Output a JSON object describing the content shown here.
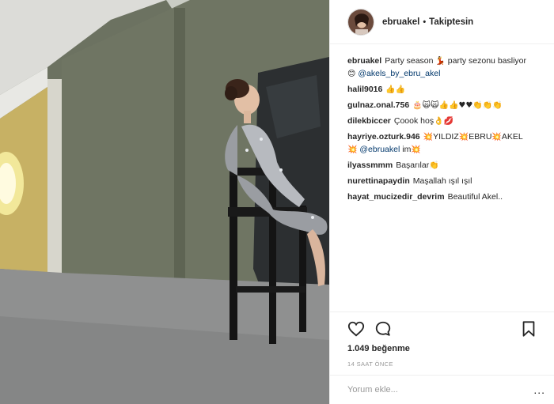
{
  "header": {
    "username": "ebruakel",
    "separator": "•",
    "follow_status": "Takiptesin"
  },
  "comments": [
    {
      "user": "ebruakel",
      "text_a": "Party season ",
      "emoji_a": "💃",
      "text_b": " party sezonu basliyor ",
      "emoji_b": "😊",
      "mention": " @akels_by_ebru_akel"
    },
    {
      "user": "halil9016",
      "emoji": "👍👍"
    },
    {
      "user": "gulnaz.onal.756",
      "emoji": "🎂🙀🙀👍👍♥♥👏👏👏"
    },
    {
      "user": "dilekbiccer",
      "text": "Çoook hoş",
      "emoji": "👌💋"
    },
    {
      "user": "hayriye.ozturk.946",
      "parts": [
        "💥",
        "YILDIZ",
        "💥",
        "EBRU",
        "💥",
        "AKEL",
        "💥"
      ],
      "mention": "@ebruakel",
      "tail": " im",
      "tail_emoji": "💥"
    },
    {
      "user": "ilyassmmm",
      "text": "Başarılar",
      "emoji": "👏"
    },
    {
      "user": "nurettinapaydin",
      "text": "Maşallah ışıl ışıl"
    },
    {
      "user": "hayat_mucizedir_devrim",
      "text": "Beautiful Akel.."
    }
  ],
  "actions": {
    "like_icon": "heart-icon",
    "comment_icon": "comment-icon",
    "save_icon": "bookmark-icon"
  },
  "likes_text": "1.049 beğenme",
  "timestamp": "14 SAAT ÖNCE",
  "comment_input": {
    "placeholder": "Yorum ekle..."
  },
  "more_label": "...",
  "colors": {
    "link": "#00376b",
    "border": "#efefef",
    "muted": "#999999",
    "wall": "#6c7261",
    "floor": "#8f9090"
  }
}
